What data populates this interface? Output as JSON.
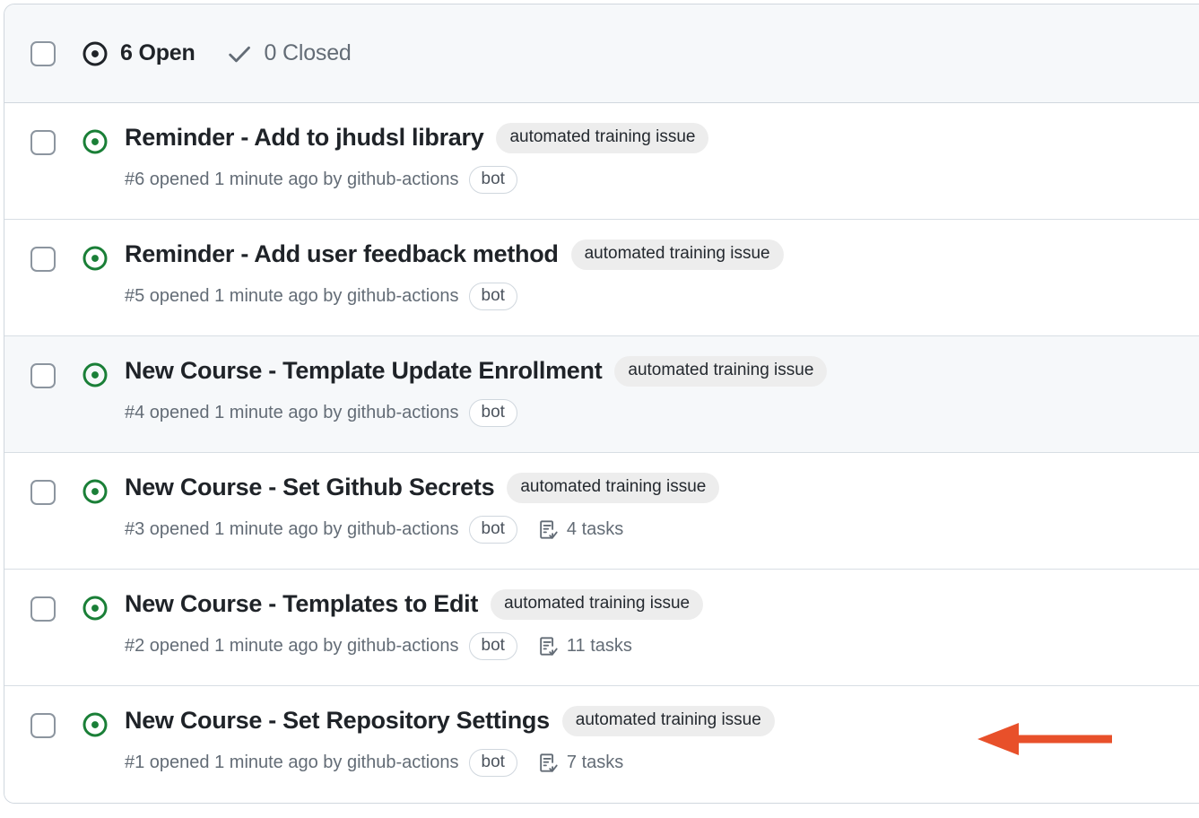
{
  "colors": {
    "open_green": "#1a7f37",
    "text_primary": "#1f2328",
    "text_muted": "#636c76",
    "label_bg": "#ededed",
    "border": "#d0d7de",
    "row_highlight": "#f6f8fa",
    "arrow_red": "#e8502a"
  },
  "header": {
    "select_all_checkbox": "unchecked",
    "open_icon": "issue-opened-icon",
    "open_label": "6 Open",
    "closed_icon": "check-icon",
    "closed_label": "0 Closed"
  },
  "issues": [
    {
      "checkbox": "unchecked",
      "state_icon": "issue-opened-icon",
      "title": "Reminder - Add to jhudsl library",
      "label": "automated training issue",
      "meta": "#6 opened 1 minute ago by github-actions",
      "author_badge": "bot",
      "tasks": null,
      "highlighted": false
    },
    {
      "checkbox": "unchecked",
      "state_icon": "issue-opened-icon",
      "title": "Reminder - Add user feedback method",
      "label": "automated training issue",
      "meta": "#5 opened 1 minute ago by github-actions",
      "author_badge": "bot",
      "tasks": null,
      "highlighted": false
    },
    {
      "checkbox": "unchecked",
      "state_icon": "issue-opened-icon",
      "title": "New Course - Template Update Enrollment",
      "label": "automated training issue",
      "meta": "#4 opened 1 minute ago by github-actions",
      "author_badge": "bot",
      "tasks": null,
      "highlighted": true
    },
    {
      "checkbox": "unchecked",
      "state_icon": "issue-opened-icon",
      "title": "New Course - Set Github Secrets",
      "label": "automated training issue",
      "meta": "#3 opened 1 minute ago by github-actions",
      "author_badge": "bot",
      "tasks": "4 tasks",
      "highlighted": false
    },
    {
      "checkbox": "unchecked",
      "state_icon": "issue-opened-icon",
      "title": "New Course - Templates to Edit",
      "label": "automated training issue",
      "meta": "#2 opened 1 minute ago by github-actions",
      "author_badge": "bot",
      "tasks": "11 tasks",
      "highlighted": false
    },
    {
      "checkbox": "unchecked",
      "state_icon": "issue-opened-icon",
      "title": "New Course - Set Repository Settings",
      "label": "automated training issue",
      "meta": "#1 opened 1 minute ago by github-actions",
      "author_badge": "bot",
      "tasks": "7 tasks",
      "highlighted": false
    }
  ],
  "annotation": {
    "icon": "left-arrow-annotation",
    "direction": "left",
    "points_at_row": "New Course - Set Repository Settings"
  }
}
